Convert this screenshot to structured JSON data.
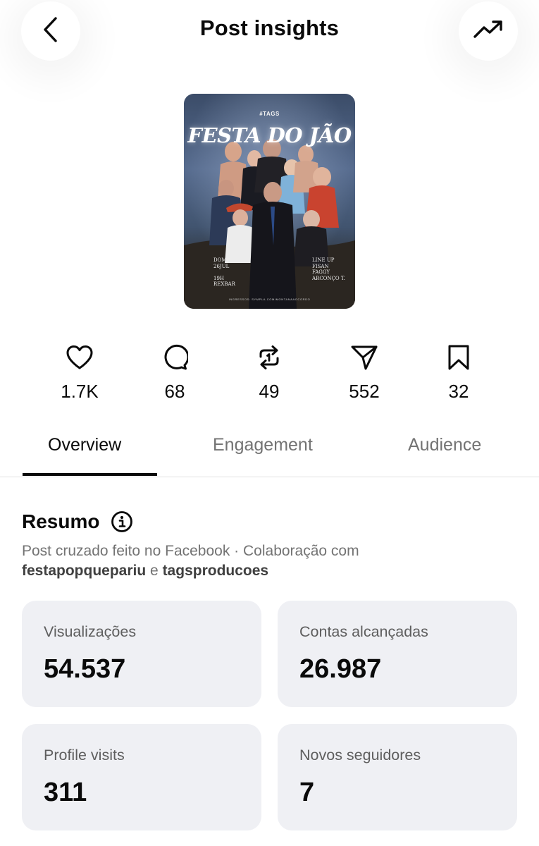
{
  "header": {
    "title": "Post insights",
    "back_icon": "chevron-left-icon",
    "trend_icon": "trending-up-icon"
  },
  "poster": {
    "brand": "#TAGS",
    "title": "FESTA DO JÃO",
    "date": "DOM,\n26JUL\n\n19H\nREXBAR",
    "lineup": "LINE UP\nFISAN\nFAGGY\nARCONÇO T.",
    "footer": "INGRESSOS: SYMPLA.COM/MONTANAAOCORDO"
  },
  "stats": [
    {
      "icon": "heart-icon",
      "value": "1.7K"
    },
    {
      "icon": "comment-icon",
      "value": "68"
    },
    {
      "icon": "repost-icon",
      "value": "49"
    },
    {
      "icon": "share-icon",
      "value": "552"
    },
    {
      "icon": "bookmark-icon",
      "value": "32"
    }
  ],
  "tabs": [
    {
      "label": "Overview",
      "active": true
    },
    {
      "label": "Engagement",
      "active": false
    },
    {
      "label": "Audience",
      "active": false
    }
  ],
  "summary": {
    "title": "Resumo",
    "description": "Post cruzado feito no Facebook · Colaboração com",
    "collaborator_1": "festapopquepariu",
    "connector": "e",
    "collaborator_2": "tagsproducoes"
  },
  "metrics": [
    {
      "label": "Visualizações",
      "value": "54.537"
    },
    {
      "label": "Contas alcançadas",
      "value": "26.987"
    },
    {
      "label": "Profile visits",
      "value": "311"
    },
    {
      "label": "Novos seguidores",
      "value": "7"
    }
  ]
}
